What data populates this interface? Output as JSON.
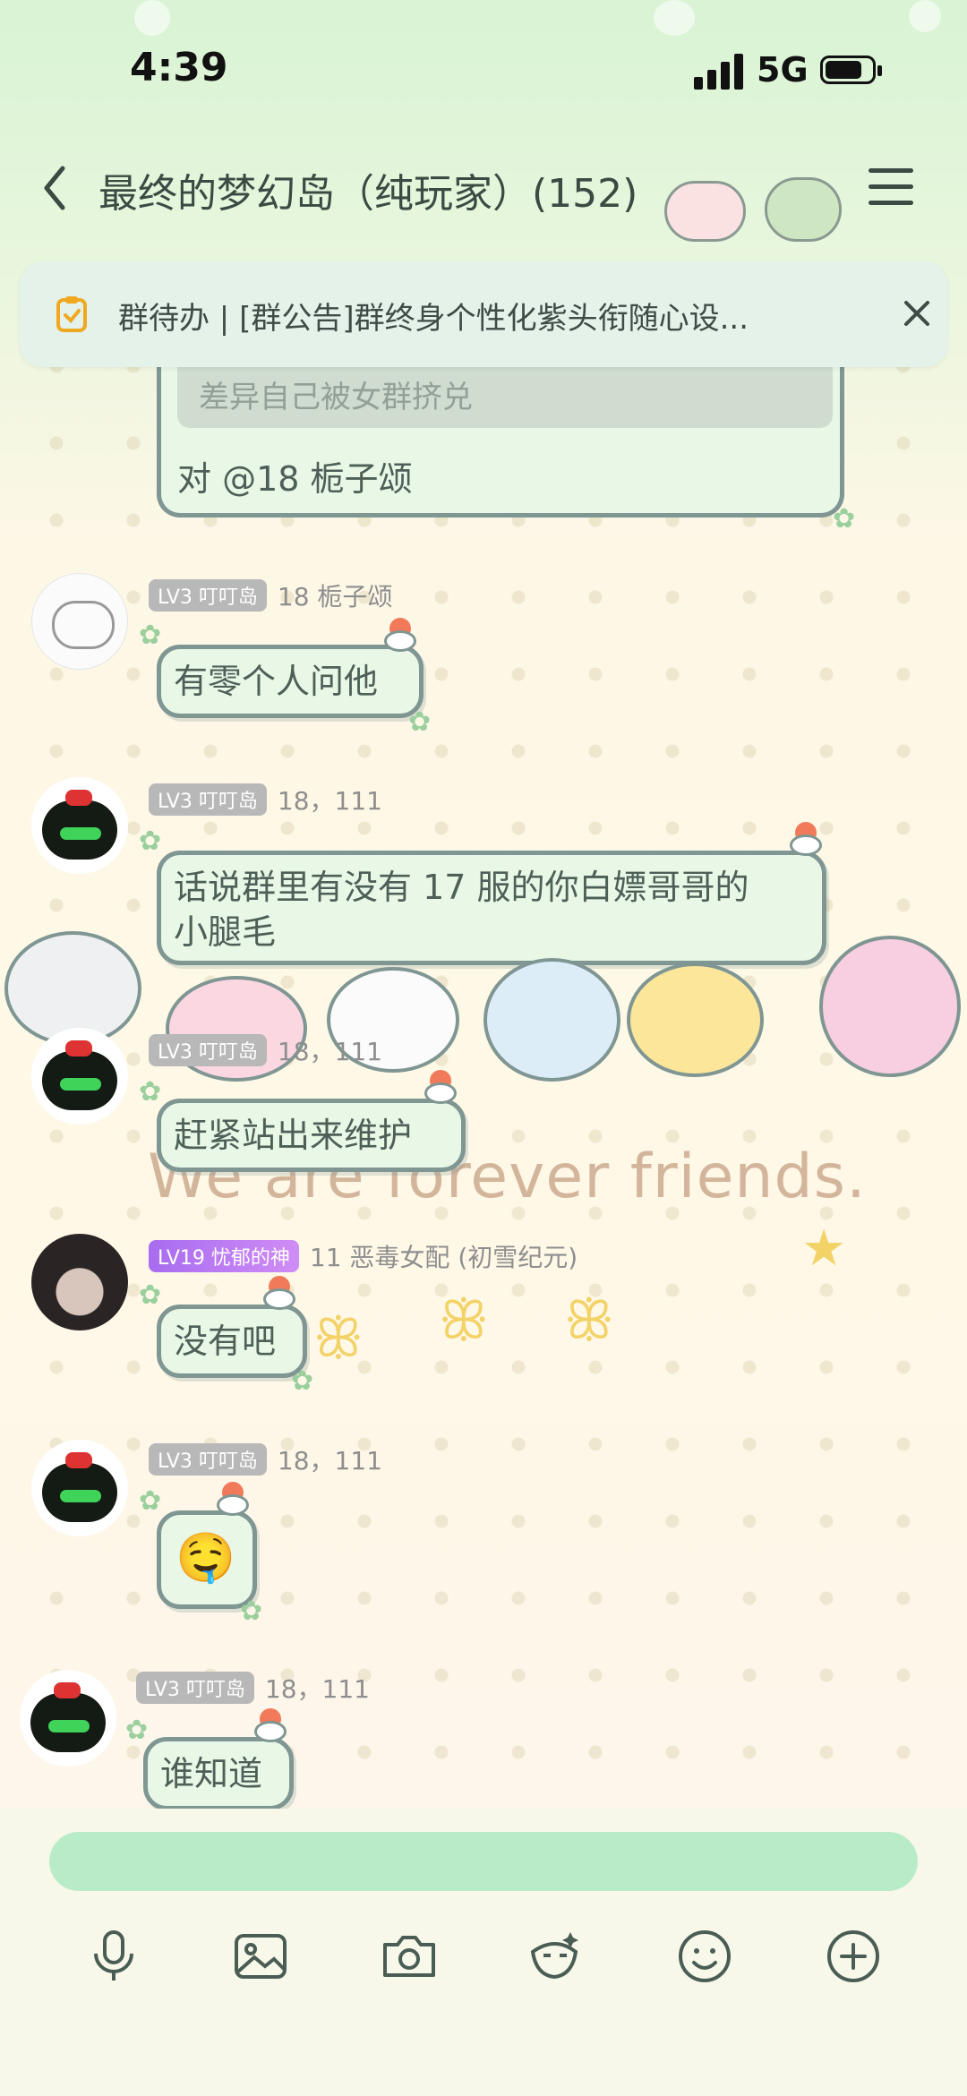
{
  "status_bar": {
    "time": "4:39",
    "network": "5G"
  },
  "header": {
    "title": "最终的梦幻岛（纯玩家）(152)"
  },
  "notice": {
    "text": "群待办 | [群公告]群终身个性化紫头衔随心设..."
  },
  "quoted_message": {
    "quote": "差异自己被女群挤兑",
    "reply": "对 @18 栀子颂"
  },
  "messages": [
    {
      "level": "LV3 叮叮岛",
      "nickname": "18 栀子颂",
      "text": "有零个人问他"
    },
    {
      "level": "LV3 叮叮岛",
      "nickname": "18，111",
      "text_line1": "话说群里有没有 17 服的你白嫖哥哥的",
      "text_line2": "小腿毛"
    },
    {
      "level": "LV3 叮叮岛",
      "nickname": "18，111",
      "text": "赶紧站出来维护"
    },
    {
      "level": "LV19 忧郁的神",
      "nickname": "11 恶毒女配 (初雪纪元)",
      "text": "没有吧"
    },
    {
      "level": "LV3 叮叮岛",
      "nickname": "18，111",
      "text": "🤤"
    },
    {
      "level": "LV3 叮叮岛",
      "nickname": "18，111",
      "text": "谁知道"
    }
  ],
  "background_text": "We are forever friends.",
  "icons": {
    "toolbar": [
      "microphone-icon",
      "image-icon",
      "camera-icon",
      "sticker-icon",
      "emoji-icon",
      "plus-icon"
    ]
  }
}
